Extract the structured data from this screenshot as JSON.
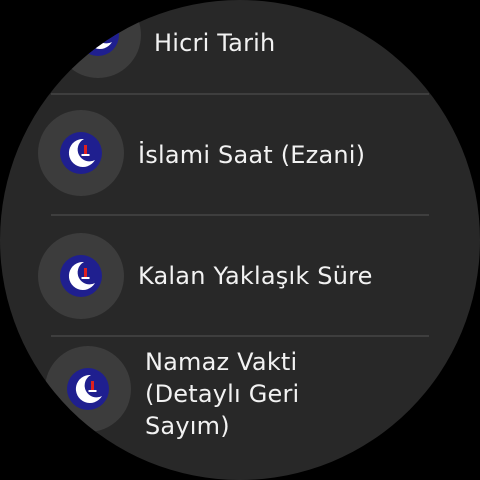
{
  "menu": {
    "items": [
      {
        "label": "Hicri Tarih",
        "icon": "crescent-moon-icon"
      },
      {
        "label": "İslami Saat (Ezani)",
        "icon": "crescent-moon-icon"
      },
      {
        "label": "Kalan Yaklaşık Süre",
        "icon": "crescent-moon-icon"
      },
      {
        "label": "Namaz Vakti (Detaylı Geri Sayım)",
        "label_lines": [
          "Namaz Vakti",
          "(Detaylı Geri",
          "Sayım)"
        ],
        "icon": "crescent-moon-icon"
      }
    ]
  },
  "colors": {
    "background": "#282828",
    "icon_circle": "#3c3c3c",
    "icon_fill": "#1f1f8f",
    "text": "#f2f2f2",
    "divider": "#3e3e3e"
  }
}
